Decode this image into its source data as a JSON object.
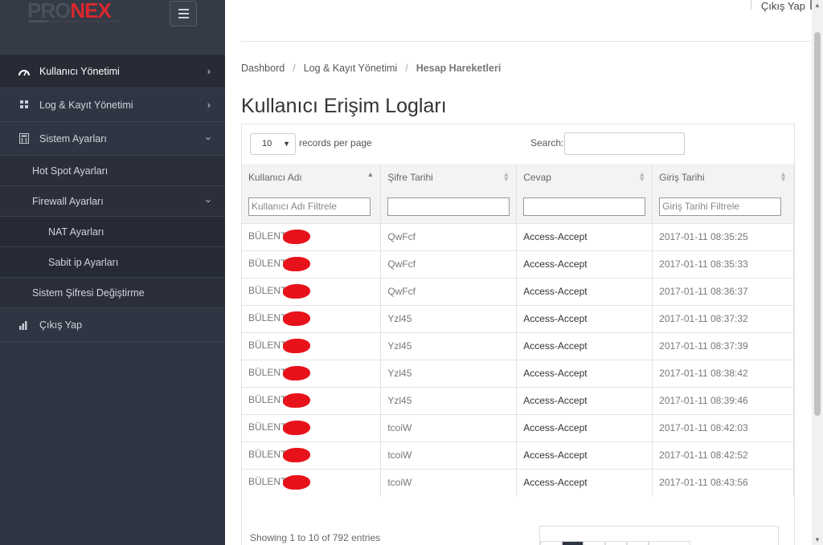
{
  "brand": {
    "logo_part1": "PRO",
    "logo_part2": "NEX",
    "accent": "#d9272e"
  },
  "sidebar": {
    "items": [
      {
        "label": "Kullanıcı Yönetimi",
        "icon": "gauge-icon",
        "chevron": "right"
      },
      {
        "label": "Log & Kayıt Yönetimi",
        "icon": "grid-icon",
        "chevron": "right"
      },
      {
        "label": "Sistem Ayarları",
        "icon": "calculator-icon",
        "chevron": "down"
      },
      {
        "label": "Hot Spot Ayarları"
      },
      {
        "label": "Firewall Ayarları",
        "chevron": "down"
      },
      {
        "label": "NAT Ayarları"
      },
      {
        "label": "Sabit ip Ayarları"
      },
      {
        "label": "Sistem Şifresi Değiştirme"
      },
      {
        "label": "Çıkış Yap",
        "icon": "bar-chart-icon"
      }
    ]
  },
  "topbar": {
    "logout_label": "Çıkış Yap",
    "logout_icon": "sign-out-icon"
  },
  "breadcrumb": [
    "Dashbord",
    "Log & Kayıt Yönetimi",
    "Hesap Hareketleri"
  ],
  "page_title": "Kullanıcı Erişim Logları",
  "table_controls": {
    "page_length": "10",
    "length_label": "records per page",
    "search_label": "Search:",
    "search_value": ""
  },
  "table": {
    "columns": [
      "Kullanıcı Adı",
      "Şifre Tarihi",
      "Cevap",
      "Giriş Tarihi"
    ],
    "filters": {
      "username_placeholder": "Kullanıcı Adı Filtrele",
      "date_placeholder": "Giriş Tarihi Filtrele"
    },
    "rows": [
      {
        "user": "BÜLENT",
        "pw": "QwFcf",
        "resp": "Access-Accept",
        "date": "2017-01-11 08:35:25"
      },
      {
        "user": "BÜLENT",
        "pw": "QwFcf",
        "resp": "Access-Accept",
        "date": "2017-01-11 08:35:33"
      },
      {
        "user": "BÜLENT",
        "pw": "QwFcf",
        "resp": "Access-Accept",
        "date": "2017-01-11 08:36:37"
      },
      {
        "user": "BÜLENT",
        "pw": "Yzl45",
        "resp": "Access-Accept",
        "date": "2017-01-11 08:37:32"
      },
      {
        "user": "BÜLENT",
        "pw": "Yzl45",
        "resp": "Access-Accept",
        "date": "2017-01-11 08:37:39"
      },
      {
        "user": "BÜLENT",
        "pw": "Yzl45",
        "resp": "Access-Accept",
        "date": "2017-01-11 08:38:42"
      },
      {
        "user": "BÜLENT",
        "pw": "Yzl45",
        "resp": "Access-Accept",
        "date": "2017-01-11 08:39:46"
      },
      {
        "user": "BÜLENT",
        "pw": "tcoiW",
        "resp": "Access-Accept",
        "date": "2017-01-11 08:42:03"
      },
      {
        "user": "BÜLENT",
        "pw": "tcoiW",
        "resp": "Access-Accept",
        "date": "2017-01-11 08:42:52"
      },
      {
        "user": "BÜLENT",
        "pw": "tcoiW",
        "resp": "Access-Accept",
        "date": "2017-01-11 08:43:56"
      }
    ]
  },
  "footer": {
    "info": "Showing 1 to 10 of 792 entries"
  }
}
